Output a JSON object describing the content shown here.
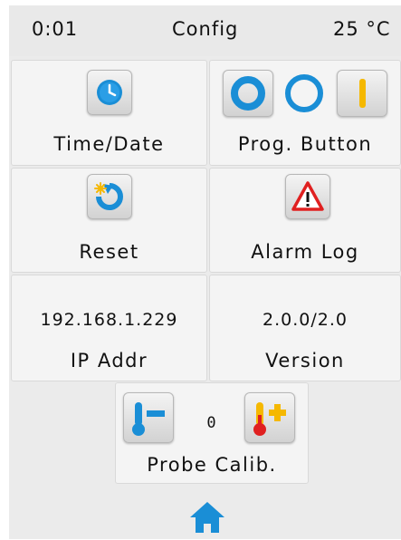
{
  "status": {
    "time": "0:01",
    "title": "Config",
    "temperature": "25 °C"
  },
  "tiles": {
    "time_date": {
      "label": "Time/Date",
      "icon": "clock-icon"
    },
    "prog_button": {
      "label": "Prog. Button",
      "icons": [
        "ring-icon",
        "thick-ring-icon",
        "bar-icon"
      ]
    },
    "reset": {
      "label": "Reset",
      "icon": "reset-icon"
    },
    "alarm_log": {
      "label": "Alarm Log",
      "icon": "warning-triangle-icon"
    },
    "ip_addr": {
      "label": "IP Addr",
      "value": "192.168.1.229"
    },
    "version": {
      "label": "Version",
      "value": "2.0.0/2.0"
    },
    "probe_calib": {
      "label": "Probe Calib.",
      "value": "0",
      "icons": [
        "thermometer-minus-icon",
        "thermometer-plus-icon"
      ]
    }
  },
  "home": {
    "icon": "home-icon"
  },
  "colors": {
    "accent_blue": "#1a8ed6",
    "accent_yellow": "#f5b800",
    "alarm_red": "#e02020"
  }
}
